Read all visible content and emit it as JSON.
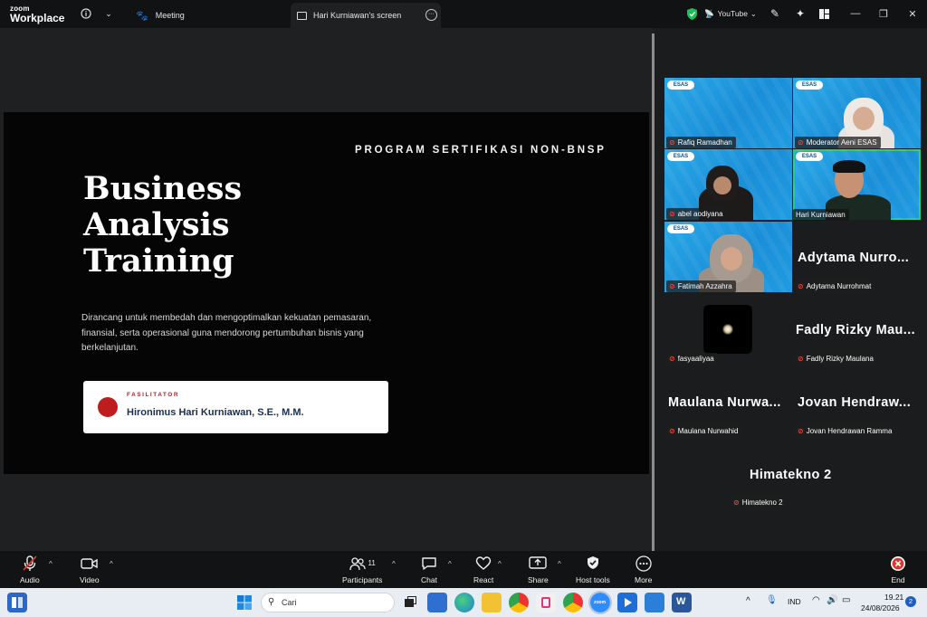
{
  "titlebar": {
    "logo_top": "zoom",
    "logo_bottom": "Workplace",
    "meeting_tab": "Meeting",
    "screen_tab": "Hari Kurniawan's screen",
    "youtube_label": "YouTube",
    "more_dots": "···"
  },
  "slide": {
    "program": "PROGRAM SERTIFIKASI NON-BNSP",
    "title_lines": [
      "Business",
      "Analysis",
      "Training"
    ],
    "description": "Dirancang untuk membedah dan mengoptimalkan kekuatan pemasaran, finansial, serta operasional guna mendorong pertumbuhan bisnis yang berkelanjutan.",
    "facilitator_label": "FASILITATOR",
    "facilitator_name": "Hironimus Hari Kurniawan, S.E., M.M."
  },
  "gallery": {
    "badge": "ESAS",
    "participants": [
      {
        "name": "Rafiq Ramadhan"
      },
      {
        "name": "Moderator Aeni ESAS"
      },
      {
        "name": "abel aodiyana"
      },
      {
        "name": "Hari Kurniawan"
      },
      {
        "name": "Fatimah Azzahra"
      },
      {
        "name": "Adytama Nurrohmat",
        "display": "Adytama  Nurro..."
      },
      {
        "name": "fasyaaliyaa"
      },
      {
        "name": "Fadly Rizky Maulana",
        "display": "Fadly Rizky Mau..."
      },
      {
        "name": "Maulana Nurwahid",
        "display": "Maulana  Nurwa..."
      },
      {
        "name": "Jovan Hendrawan Ramma",
        "display": "Jovan  Hendraw..."
      },
      {
        "name": "Himatekno 2",
        "display": "Himatekno 2"
      }
    ]
  },
  "toolbar": {
    "audio": "Audio",
    "video": "Video",
    "participants": "Participants",
    "participants_count": "11",
    "chat": "Chat",
    "react": "React",
    "share": "Share",
    "host_tools": "Host tools",
    "more": "More",
    "end": "End"
  },
  "taskbar": {
    "search_placeholder": "Cari",
    "lang": "IND",
    "time": "19.21",
    "date": "24/08/2026",
    "notif_count": "2"
  },
  "colors": {
    "accent_speaking": "#2ecc71",
    "end_red": "#e0342b",
    "facilitator_red": "#bd1d1d",
    "shield_green": "#1fbf5a"
  }
}
